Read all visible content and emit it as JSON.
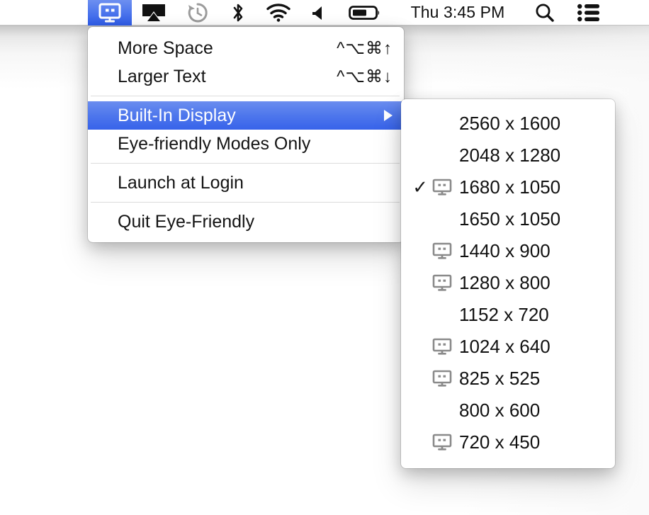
{
  "menubar": {
    "status_icons": [
      {
        "name": "eye-friendly-display-icon",
        "label": "Eye-Friendly Display",
        "active": true
      },
      {
        "name": "airplay-icon",
        "label": "AirPlay",
        "active": false
      },
      {
        "name": "time-machine-icon",
        "label": "Time Machine",
        "active": false
      },
      {
        "name": "bluetooth-icon",
        "label": "Bluetooth",
        "active": false
      },
      {
        "name": "wifi-icon",
        "label": "Wi-Fi",
        "active": false
      },
      {
        "name": "volume-icon",
        "label": "Volume",
        "active": false
      },
      {
        "name": "battery-icon",
        "label": "Battery",
        "active": false
      }
    ],
    "clock": "Thu 3:45 PM",
    "spotlight_label": "Spotlight Search",
    "notification_center_label": "Notification Center"
  },
  "main_menu": {
    "items": [
      {
        "type": "item",
        "label": "More Space",
        "shortcut": "^⌥⌘↑",
        "highlight": false,
        "submenu": false
      },
      {
        "type": "item",
        "label": "Larger Text",
        "shortcut": "^⌥⌘↓",
        "highlight": false,
        "submenu": false
      },
      {
        "type": "separator"
      },
      {
        "type": "item",
        "label": "Built-In Display",
        "shortcut": "",
        "highlight": true,
        "submenu": true
      },
      {
        "type": "item",
        "label": "Eye-friendly Modes Only",
        "shortcut": "",
        "highlight": false,
        "submenu": false
      },
      {
        "type": "separator"
      },
      {
        "type": "item",
        "label": "Launch at Login",
        "shortcut": "",
        "highlight": false,
        "submenu": false
      },
      {
        "type": "separator"
      },
      {
        "type": "item",
        "label": "Quit Eye-Friendly",
        "shortcut": "",
        "highlight": false,
        "submenu": false
      }
    ]
  },
  "submenu": {
    "title": "Built-In Display",
    "resolutions": [
      {
        "label": "2560 x 1600",
        "checked": false,
        "display_icon": false
      },
      {
        "label": "2048 x 1280",
        "checked": false,
        "display_icon": false
      },
      {
        "label": "1680 x 1050",
        "checked": true,
        "display_icon": true
      },
      {
        "label": "1650 x 1050",
        "checked": false,
        "display_icon": false
      },
      {
        "label": "1440 x 900",
        "checked": false,
        "display_icon": true
      },
      {
        "label": "1280 x 800",
        "checked": false,
        "display_icon": true
      },
      {
        "label": "1152 x 720",
        "checked": false,
        "display_icon": false
      },
      {
        "label": "1024 x 640",
        "checked": false,
        "display_icon": true
      },
      {
        "label": "825 x 525",
        "checked": false,
        "display_icon": true
      },
      {
        "label": "800 x 600",
        "checked": false,
        "display_icon": false
      },
      {
        "label": "720 x 450",
        "checked": false,
        "display_icon": true
      }
    ],
    "check_glyph": "✓"
  },
  "colors": {
    "highlight_blue": "#4e77ec",
    "menu_background": "#ffffff",
    "text": "#141414",
    "icon_gray": "#8a8a8a",
    "separator": "#dcdcdc"
  }
}
